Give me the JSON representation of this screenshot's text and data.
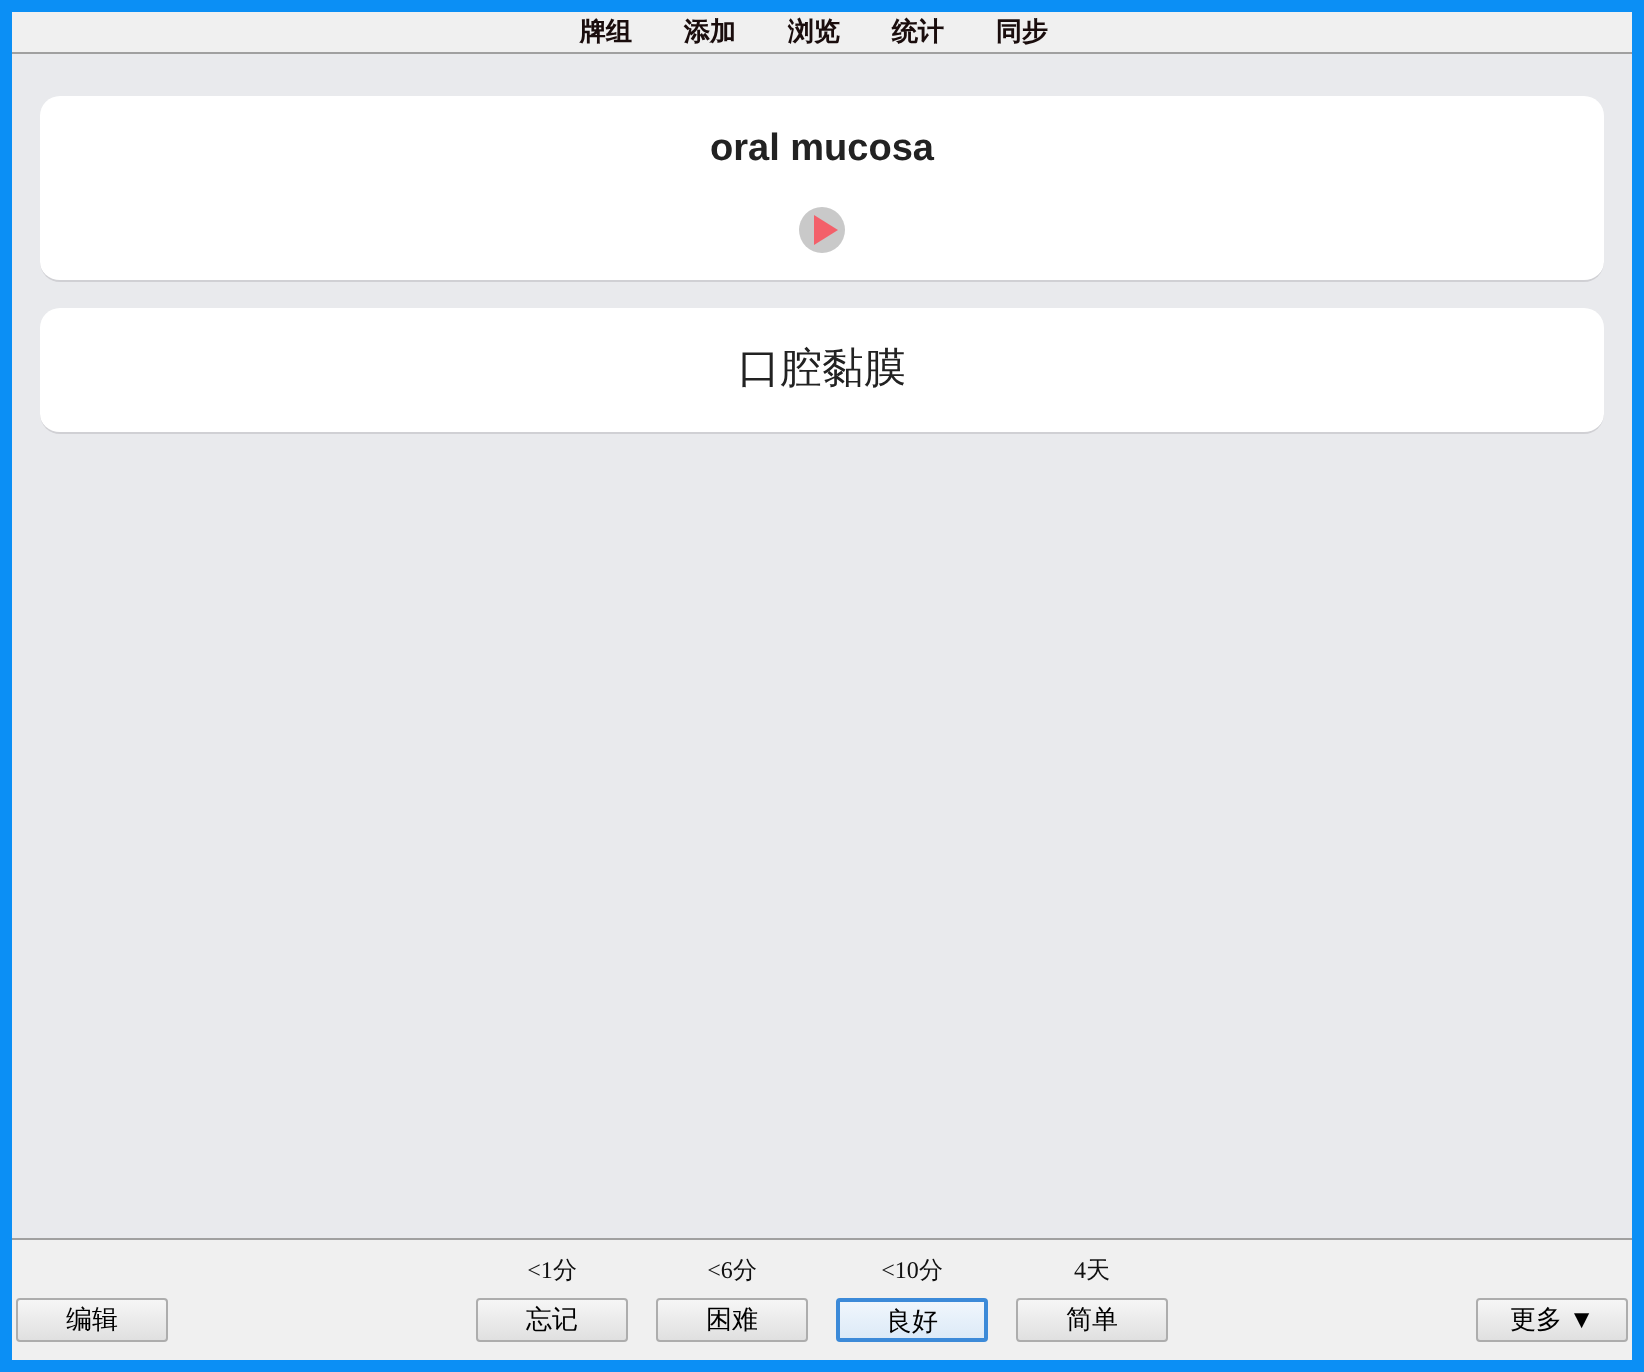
{
  "menu": [
    "牌组",
    "添加",
    "浏览",
    "统计",
    "同步"
  ],
  "cards": [
    {
      "kind": "front",
      "text": "oral mucosa",
      "audio": true
    },
    {
      "kind": "back",
      "text": "口腔黏膜",
      "audio": false
    }
  ],
  "edit_button": "编辑",
  "answers": [
    {
      "interval": "<1分",
      "label": "忘记",
      "selected": false
    },
    {
      "interval": "<6分",
      "label": "困难",
      "selected": false
    },
    {
      "interval": "<10分",
      "label": "良好",
      "selected": true
    },
    {
      "interval": "4天",
      "label": "简单",
      "selected": false
    }
  ],
  "more_button": "更多 ▼"
}
